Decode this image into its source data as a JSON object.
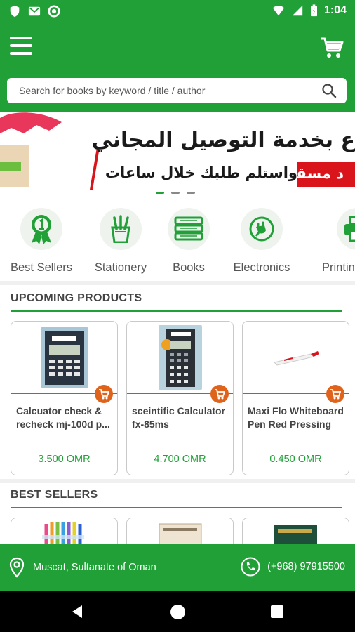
{
  "status_bar": {
    "time": "1:04",
    "icons_left": [
      "shield-icon",
      "gmail-icon",
      "circle-icon"
    ],
    "icons_right": [
      "wifi-icon",
      "signal-icon",
      "battery-icon"
    ]
  },
  "app_bar": {
    "menu_icon": "hamburger-icon",
    "cart_icon": "cart-icon",
    "search_placeholder": "Search for books by keyword / title / author",
    "search_icon": "search-icon"
  },
  "banner": {
    "line1": "ع بخدمة التوصيل المجاني",
    "line2": "واستلم طلبك خلال ساعات",
    "tag": "د مسقط",
    "slides": 3,
    "active_slide": 1
  },
  "categories": [
    {
      "label": "Best Sellers",
      "icon": "ribbon-badge-icon"
    },
    {
      "label": "Stationery",
      "icon": "pencil-cup-icon"
    },
    {
      "label": "Books",
      "icon": "books-stack-icon"
    },
    {
      "label": "Electronics",
      "icon": "plug-icon"
    },
    {
      "label": "Printing",
      "icon": "printer-icon"
    }
  ],
  "upcoming": {
    "title": "UPCOMING PRODUCTS",
    "products": [
      {
        "name": "Calcuator check & recheck mj-100d p...",
        "price": "3.500 OMR",
        "image": "calculator-image"
      },
      {
        "name": "sceintific Calculator fx-85ms",
        "price": "4.700 OMR",
        "image": "scientific-calculator-image"
      },
      {
        "name": "Maxi Flo Whiteboard Pen Red Pressing",
        "price": "0.450 OMR",
        "image": "marker-pen-image"
      }
    ]
  },
  "best_sellers": {
    "title": "BEST SELLERS",
    "products": [
      {
        "image": "colored-pens-image"
      },
      {
        "image": "book-image"
      },
      {
        "image": "green-book-image"
      }
    ]
  },
  "contact": {
    "location": "Muscat, Sultanate of Oman",
    "phone": "(+968) 97915500"
  },
  "colors": {
    "primary": "#21a038",
    "accent_cart": "#e0631c",
    "banner_tag": "#d9141b"
  }
}
